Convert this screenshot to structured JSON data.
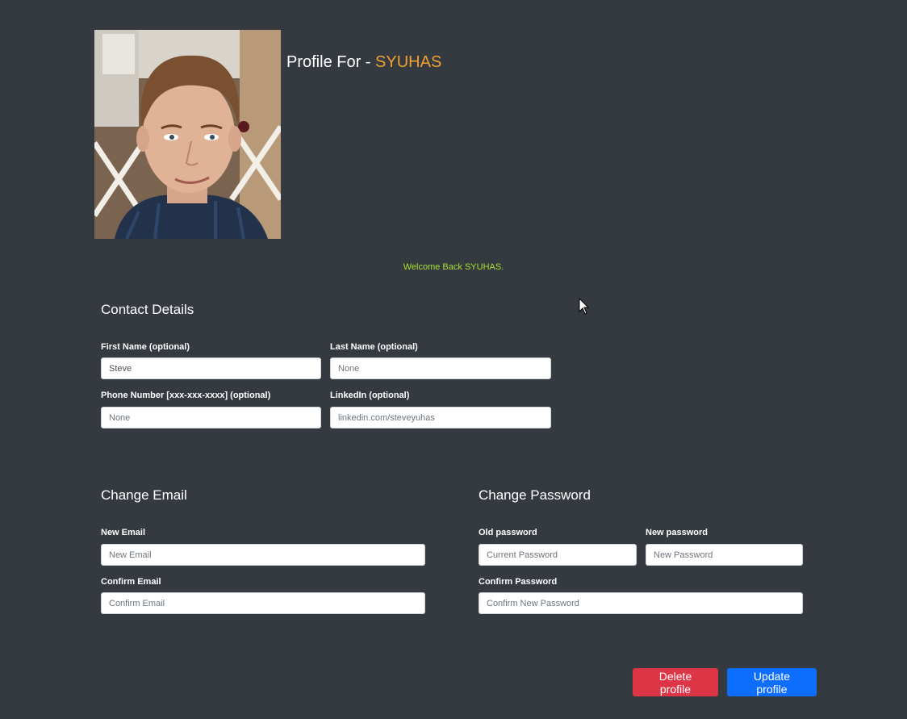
{
  "profile": {
    "title_prefix": "Profile For - ",
    "username": "SYUHAS",
    "welcome": "Welcome Back SYUHAS."
  },
  "contact": {
    "heading": "Contact Details",
    "first_name": {
      "label": "First Name (optional)",
      "value": "Steve"
    },
    "last_name": {
      "label": "Last Name (optional)",
      "placeholder": "None"
    },
    "phone": {
      "label": "Phone Number [xxx-xxx-xxxx] (optional)",
      "placeholder": "None"
    },
    "linkedin": {
      "label": "LinkedIn (optional)",
      "placeholder": "linkedin.com/steveyuhas"
    }
  },
  "email": {
    "heading": "Change Email",
    "new_email": {
      "label": "New Email",
      "placeholder": "New Email"
    },
    "confirm_email": {
      "label": "Confirm Email",
      "placeholder": "Confirm Email"
    }
  },
  "password": {
    "heading": "Change Password",
    "old_password": {
      "label": "Old password",
      "placeholder": "Current Password"
    },
    "new_password": {
      "label": "New password",
      "placeholder": "New Password"
    },
    "confirm_password": {
      "label": "Confirm Password",
      "placeholder": "Confirm New Password"
    }
  },
  "actions": {
    "delete_label": "Delete profile",
    "update_label": "Update profile"
  },
  "colors": {
    "background": "#343a40",
    "username_accent": "#f0a030",
    "welcome_text": "#a6e22e",
    "danger": "#dc3545",
    "primary": "#0d6efd"
  }
}
